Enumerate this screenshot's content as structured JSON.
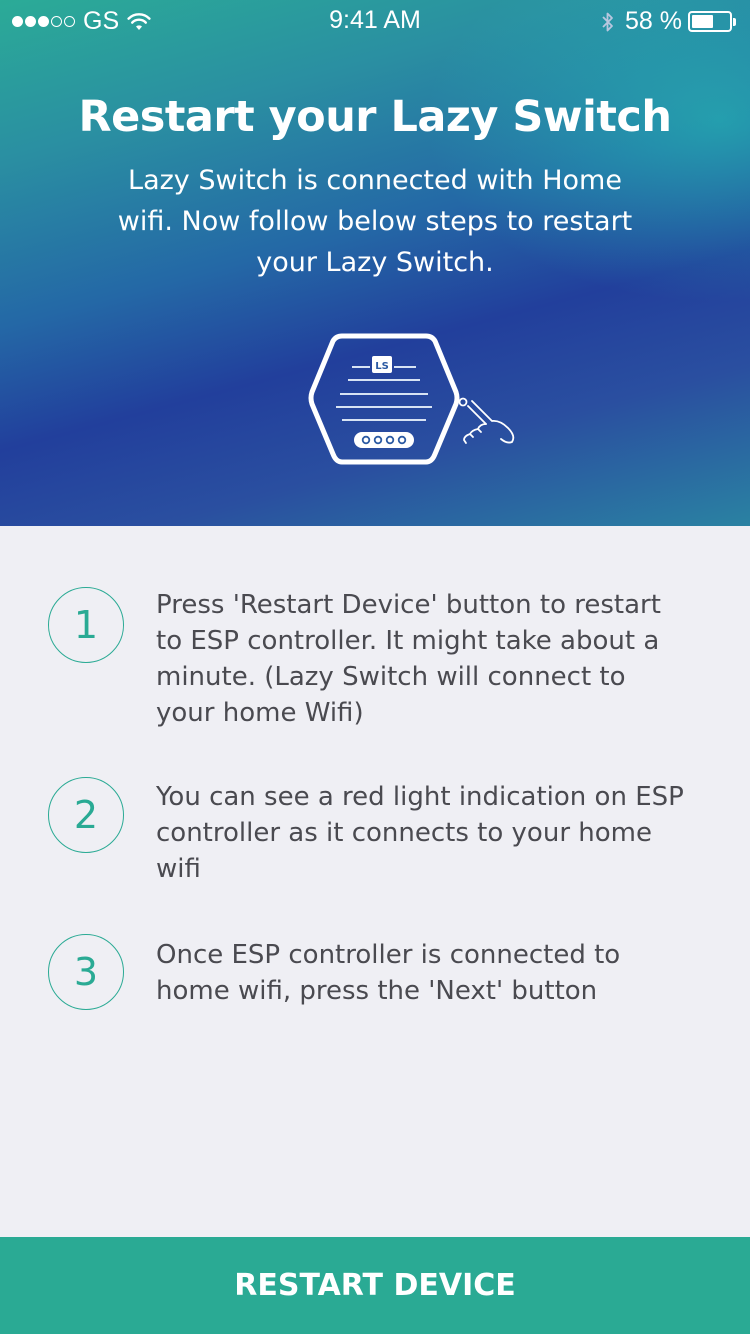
{
  "status_bar": {
    "carrier": "GS",
    "time": "9:41 AM",
    "battery_percent": "58 %",
    "battery_level": 0.58,
    "signal_bars_filled": 3,
    "signal_bars_total": 5,
    "icons": [
      "signal-dots-icon",
      "wifi-icon",
      "bluetooth-icon",
      "battery-icon"
    ]
  },
  "header": {
    "title": "Restart your Lazy Switch",
    "subtitle": "Lazy Switch is connected with Home wifi. Now follow below steps to restart your Lazy Switch.",
    "illustration": {
      "badge_text": "LS",
      "icon": "hexagon-device-icon",
      "hand_icon": "pointing-hand-icon"
    }
  },
  "steps": [
    {
      "number": "1",
      "text": "Press 'Restart Device' button to restart to ESP controller. It might take about a minute. (Lazy Switch will connect to your home Wifi)"
    },
    {
      "number": "2",
      "text": "You can see a red light indication on ESP controller as it connects to your home wifi"
    },
    {
      "number": "3",
      "text": "Once ESP controller is connected to home wifi, press the 'Next' button"
    }
  ],
  "footer": {
    "button_label": "RESTART DEVICE"
  },
  "colors": {
    "accent": "#2aaa94",
    "background": "#efeff4",
    "text": "#4a4a50",
    "header_gradient_start": "#2bab97",
    "header_gradient_mid": "#223f9c"
  }
}
